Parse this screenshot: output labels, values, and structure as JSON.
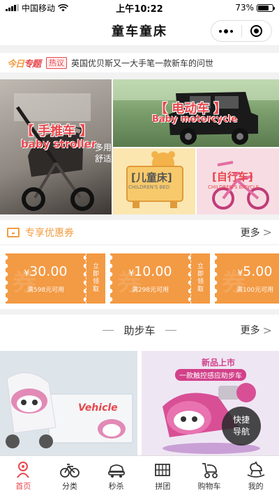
{
  "status_bar": {
    "carrier": "中国移动",
    "time": "上午10:22",
    "battery": "73%",
    "battery_level": 0.73
  },
  "nav": {
    "title": "童车童床"
  },
  "ticker": {
    "logo_a": "今日",
    "logo_b": "专题",
    "tag": "热议",
    "text": "英国优贝斯又一大手笔一款新车的问世"
  },
  "banners": {
    "stroller": {
      "title": "【 手推车 】",
      "subtitle": "baby stroller",
      "side_text_1": "多用",
      "side_text_2": "舒适"
    },
    "motorcycle": {
      "title": "【 电动车 】",
      "subtitle": "Baby motorcycle"
    },
    "bed": {
      "title": "[儿童床]",
      "subtitle": "CHILDREN'S BED"
    },
    "bicycle": {
      "title": "[自行车]",
      "subtitle": "CHILDREN'S BICYCLE"
    }
  },
  "coupons": {
    "title": "专享优惠券",
    "more": "更多",
    "watermark": "券",
    "items": [
      {
        "currency": "¥",
        "amount": "30.00",
        "condition": "满598元可用",
        "action": [
          "立",
          "即",
          "领",
          "取"
        ]
      },
      {
        "currency": "¥",
        "amount": "10.00",
        "condition": "满298元可用",
        "action": [
          "立",
          "即",
          "领",
          "取"
        ]
      },
      {
        "currency": "¥",
        "amount": "5.00",
        "condition": "满100元可用",
        "action": [
          "立",
          "即",
          "领",
          "取"
        ]
      }
    ]
  },
  "category": {
    "title": "助步车",
    "more": "更多",
    "product_1": {
      "brand": "Vehicle"
    },
    "product_2": {
      "tag": "新品上市",
      "subtitle": "一款触控感应助步车"
    }
  },
  "float_button": {
    "line_1": "快捷",
    "line_2": "导航"
  },
  "tab_bar": {
    "items": [
      {
        "label": "首页",
        "icon": "home-baby-icon"
      },
      {
        "label": "分类",
        "icon": "bicycle-icon"
      },
      {
        "label": "秒杀",
        "icon": "car-icon"
      },
      {
        "label": "拼团",
        "icon": "crib-icon"
      },
      {
        "label": "购物车",
        "icon": "stroller-icon"
      },
      {
        "label": "我的",
        "icon": "rocking-horse-icon"
      }
    ],
    "active_color": "#e8474c"
  },
  "colors": {
    "accent_red": "#e8474c",
    "coupon_orange": "#f39a44"
  }
}
